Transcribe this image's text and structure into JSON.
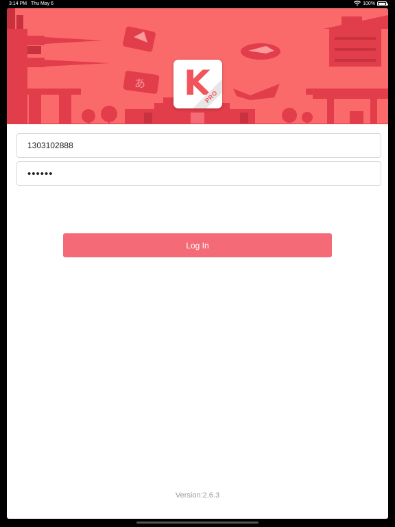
{
  "status_bar": {
    "time": "3:14 PM",
    "date": "Thu May 6",
    "battery": "100%",
    "icons": [
      "wifi-icon",
      "battery-icon"
    ]
  },
  "banner": {
    "color": "#fb6a6a",
    "accent": "#e23d4b",
    "logo": {
      "letter": "K",
      "badge": "PRO",
      "color": "#f2545b"
    }
  },
  "login_form": {
    "phone_value": "1303102888",
    "password_value": "••••••",
    "login_label": "Log In",
    "button_color": "#f46b77"
  },
  "footer": {
    "version": "Version:2.6.3"
  }
}
